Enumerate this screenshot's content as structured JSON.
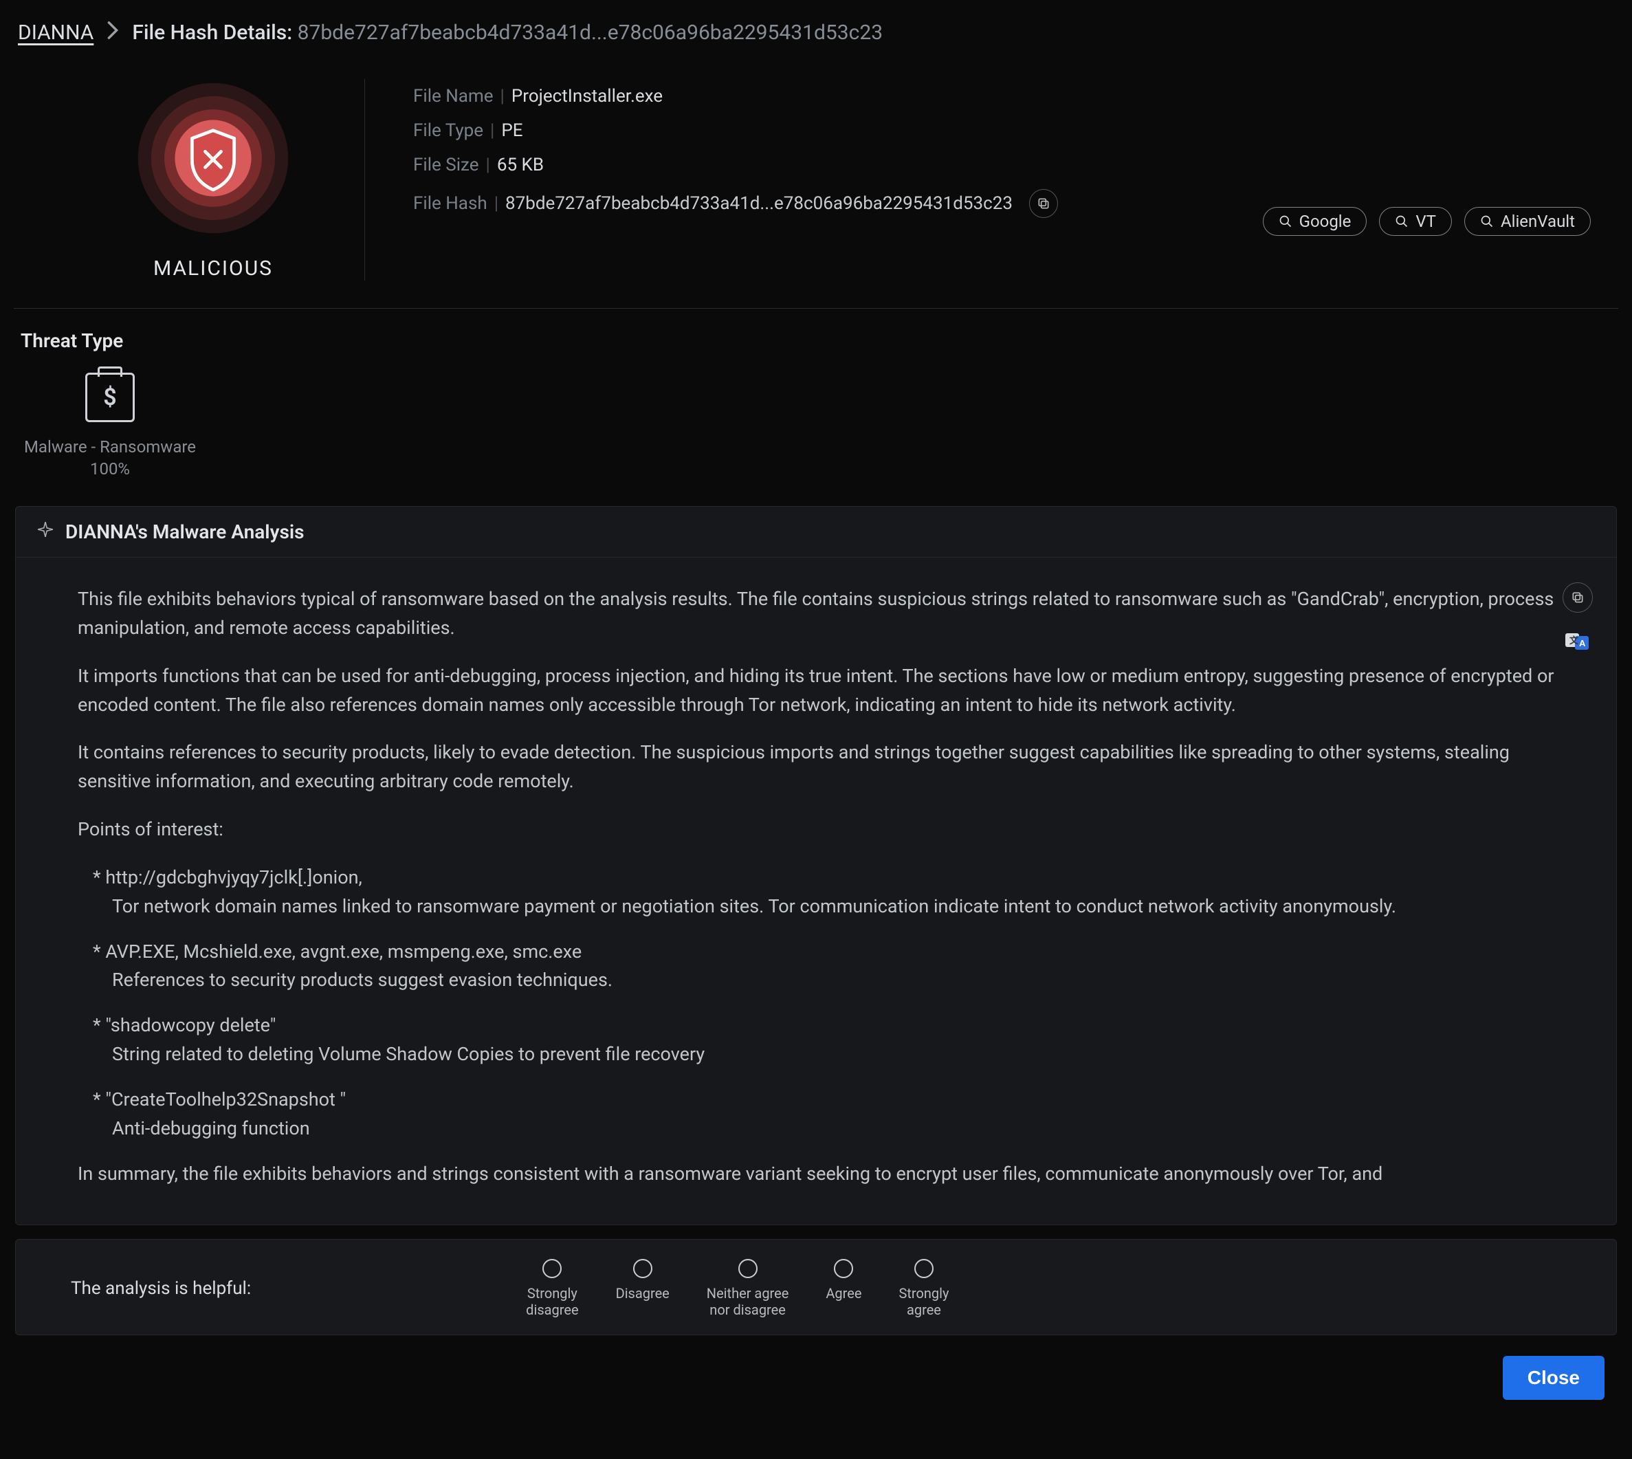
{
  "breadcrumb": {
    "root": "DIANNA",
    "page_label": "File Hash Details:",
    "hash": "87bde727af7beabcb4d733a41d...e78c06a96ba2295431d53c23"
  },
  "verdict": "MALICIOUS",
  "meta": {
    "file_name_label": "File Name",
    "file_name": "ProjectInstaller.exe",
    "file_type_label": "File Type",
    "file_type": "PE",
    "file_size_label": "File Size",
    "file_size": "65 KB",
    "file_hash_label": "File Hash",
    "file_hash": "87bde727af7beabcb4d733a41d...e78c06a96ba2295431d53c23"
  },
  "links": {
    "google": "Google",
    "vt": "VT",
    "alienvault": "AlienVault"
  },
  "threat": {
    "section_title": "Threat Type",
    "name": "Malware - Ransomware",
    "pct": "100%",
    "glyph": "$"
  },
  "analysis": {
    "panel_title": "DIANNA's Malware Analysis",
    "p1": "This file exhibits behaviors typical of ransomware based on the analysis results. The file contains suspicious strings related to ransomware such as \"GandCrab\", encryption, process manipulation, and remote access capabilities.",
    "p2": "It imports functions that can be used for anti-debugging, process injection, and hiding its true intent. The sections have low or medium entropy, suggesting presence of encrypted or encoded content. The file also references domain names only accessible through Tor network, indicating an intent to hide its network activity.",
    "p3": "It contains references to security products, likely to evade detection. The suspicious imports and strings together suggest capabilities like spreading to other systems, stealing sensitive information, and executing arbitrary code remotely.",
    "poi_header": "Points of interest:",
    "poi": [
      {
        "l1": "http://gdcbghvjyqy7jclk[.]onion,",
        "l2": "Tor network domain names linked to ransomware payment or negotiation sites. Tor communication indicate intent to conduct network activity anonymously."
      },
      {
        "l1": "AVP.EXE, Mcshield.exe, avgnt.exe, msmpeng.exe, smc.exe",
        "l2": "References to security products suggest evasion techniques."
      },
      {
        "l1": "\"shadowcopy delete\"",
        "l2": "String related to deleting Volume Shadow Copies to prevent file recovery"
      },
      {
        "l1": "\"CreateToolhelp32Snapshot \"",
        "l2": "Anti-debugging function"
      }
    ],
    "summary": "In summary, the file exhibits behaviors and strings consistent with a ransomware variant seeking to encrypt user files, communicate anonymously over Tor, and"
  },
  "feedback": {
    "prompt": "The analysis is helpful:",
    "options": [
      "Strongly disagree",
      "Disagree",
      "Neither agree nor disagree",
      "Agree",
      "Strongly agree"
    ]
  },
  "close_label": "Close"
}
